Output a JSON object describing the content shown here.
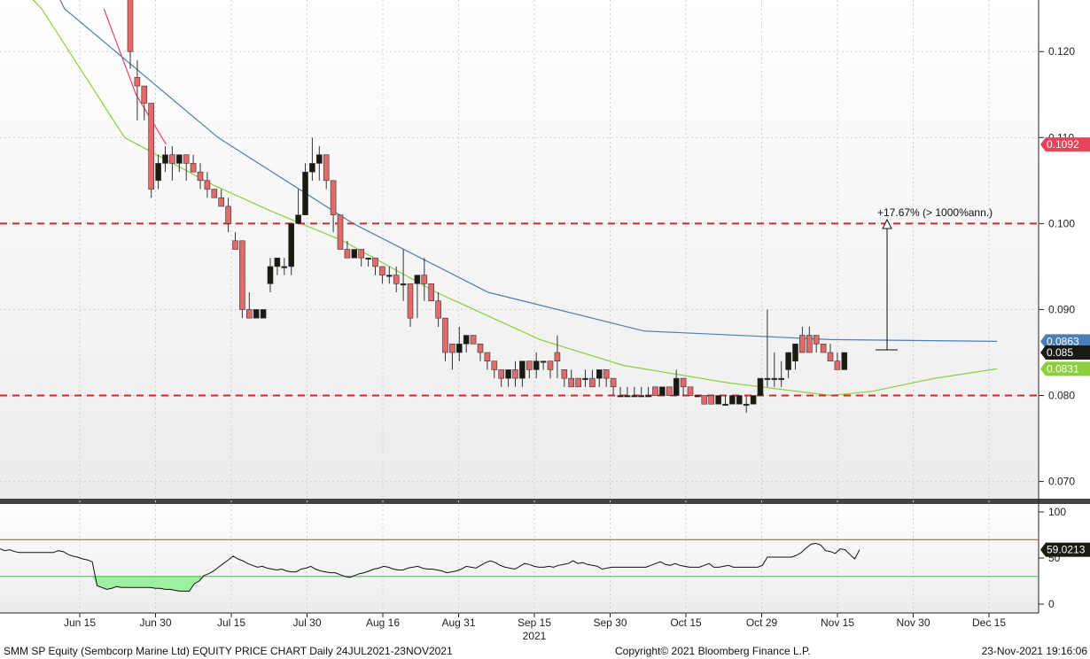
{
  "chart_data": [
    {
      "type": "candlestick",
      "title": "",
      "y_axis_side": "right",
      "ylim": [
        0.068,
        0.126
      ],
      "y_ticks": [
        "0.070",
        "0.080",
        "0.090",
        "0.100",
        "0.110",
        "0.120"
      ],
      "x_ticks": [
        "Jun 15",
        "Jun 30",
        "Jul 15",
        "Jul 30",
        "Aug 16",
        "Aug 31",
        "Sep 15",
        "Sep 30",
        "Oct 15",
        "Oct 29",
        "Nov 15",
        "Nov 30",
        "Dec 15"
      ],
      "x_year_label": "2021",
      "candles": [
        [
          0.13,
          0.131,
          0.118,
          0.12
        ],
        [
          0.117,
          0.119,
          0.112,
          0.116
        ],
        [
          0.116,
          0.116,
          0.112,
          0.114
        ],
        [
          0.114,
          0.114,
          0.103,
          0.104
        ],
        [
          0.105,
          0.108,
          0.104,
          0.107
        ],
        [
          0.107,
          0.109,
          0.106,
          0.108
        ],
        [
          0.108,
          0.109,
          0.105,
          0.107
        ],
        [
          0.107,
          0.108,
          0.106,
          0.108
        ],
        [
          0.108,
          0.108,
          0.105,
          0.107
        ],
        [
          0.107,
          0.108,
          0.106,
          0.106
        ],
        [
          0.106,
          0.107,
          0.104,
          0.105
        ],
        [
          0.105,
          0.106,
          0.103,
          0.104
        ],
        [
          0.104,
          0.104,
          0.103,
          0.103
        ],
        [
          0.103,
          0.104,
          0.102,
          0.102
        ],
        [
          0.102,
          0.103,
          0.099,
          0.1
        ],
        [
          0.098,
          0.099,
          0.097,
          0.097
        ],
        [
          0.098,
          0.098,
          0.089,
          0.09
        ],
        [
          0.09,
          0.092,
          0.089,
          0.089
        ],
        [
          0.089,
          0.09,
          0.089,
          0.09
        ],
        [
          0.089,
          0.09,
          0.089,
          0.09
        ],
        [
          0.093,
          0.096,
          0.092,
          0.095
        ],
        [
          0.095,
          0.096,
          0.094,
          0.096
        ],
        [
          0.095,
          0.096,
          0.094,
          0.095
        ],
        [
          0.095,
          0.1,
          0.094,
          0.1
        ],
        [
          0.1,
          0.104,
          0.1,
          0.101
        ],
        [
          0.101,
          0.107,
          0.101,
          0.106
        ],
        [
          0.106,
          0.11,
          0.105,
          0.107
        ],
        [
          0.107,
          0.109,
          0.105,
          0.108
        ],
        [
          0.108,
          0.108,
          0.104,
          0.105
        ],
        [
          0.105,
          0.105,
          0.099,
          0.101
        ],
        [
          0.101,
          0.101,
          0.098,
          0.097
        ],
        [
          0.097,
          0.098,
          0.096,
          0.096
        ],
        [
          0.096,
          0.097,
          0.096,
          0.097
        ],
        [
          0.097,
          0.097,
          0.095,
          0.096
        ],
        [
          0.096,
          0.096,
          0.095,
          0.096
        ],
        [
          0.096,
          0.096,
          0.094,
          0.095
        ],
        [
          0.095,
          0.095,
          0.093,
          0.094
        ],
        [
          0.094,
          0.095,
          0.093,
          0.094
        ],
        [
          0.094,
          0.095,
          0.092,
          0.093
        ],
        [
          0.093,
          0.097,
          0.091,
          0.093
        ],
        [
          0.093,
          0.093,
          0.088,
          0.089
        ],
        [
          0.093,
          0.094,
          0.089,
          0.094
        ],
        [
          0.094,
          0.096,
          0.091,
          0.093
        ],
        [
          0.093,
          0.093,
          0.091,
          0.091
        ],
        [
          0.091,
          0.092,
          0.088,
          0.089
        ],
        [
          0.089,
          0.089,
          0.084,
          0.085
        ],
        [
          0.086,
          0.086,
          0.083,
          0.085
        ],
        [
          0.085,
          0.088,
          0.084,
          0.086
        ],
        [
          0.086,
          0.087,
          0.085,
          0.087
        ],
        [
          0.087,
          0.087,
          0.086,
          0.086
        ],
        [
          0.086,
          0.086,
          0.084,
          0.085
        ],
        [
          0.085,
          0.085,
          0.083,
          0.084
        ],
        [
          0.084,
          0.084,
          0.082,
          0.083
        ],
        [
          0.083,
          0.083,
          0.081,
          0.082
        ],
        [
          0.082,
          0.083,
          0.081,
          0.083
        ],
        [
          0.083,
          0.084,
          0.081,
          0.082
        ],
        [
          0.082,
          0.084,
          0.081,
          0.084
        ],
        [
          0.084,
          0.084,
          0.082,
          0.083
        ],
        [
          0.083,
          0.085,
          0.082,
          0.084
        ],
        [
          0.084,
          0.084,
          0.083,
          0.084
        ],
        [
          0.084,
          0.084,
          0.082,
          0.083
        ],
        [
          0.085,
          0.087,
          0.082,
          0.084
        ],
        [
          0.083,
          0.083,
          0.081,
          0.082
        ],
        [
          0.082,
          0.083,
          0.081,
          0.081
        ],
        [
          0.082,
          0.082,
          0.081,
          0.081
        ],
        [
          0.082,
          0.083,
          0.081,
          0.082
        ],
        [
          0.082,
          0.083,
          0.081,
          0.081
        ],
        [
          0.082,
          0.083,
          0.081,
          0.083
        ],
        [
          0.083,
          0.083,
          0.081,
          0.082
        ],
        [
          0.082,
          0.082,
          0.08,
          0.081
        ],
        [
          0.08,
          0.081,
          0.08,
          0.08
        ],
        [
          0.08,
          0.081,
          0.08,
          0.08
        ],
        [
          0.08,
          0.081,
          0.08,
          0.08
        ],
        [
          0.08,
          0.081,
          0.08,
          0.08
        ],
        [
          0.08,
          0.081,
          0.08,
          0.08
        ],
        [
          0.081,
          0.081,
          0.08,
          0.08
        ],
        [
          0.08,
          0.081,
          0.08,
          0.081
        ],
        [
          0.081,
          0.081,
          0.08,
          0.08
        ],
        [
          0.08,
          0.083,
          0.08,
          0.082
        ],
        [
          0.082,
          0.082,
          0.08,
          0.081
        ],
        [
          0.081,
          0.081,
          0.08,
          0.08
        ],
        [
          0.08,
          0.08,
          0.08,
          0.08
        ],
        [
          0.08,
          0.08,
          0.079,
          0.079
        ],
        [
          0.08,
          0.08,
          0.079,
          0.079
        ],
        [
          0.079,
          0.08,
          0.079,
          0.08
        ],
        [
          0.079,
          0.08,
          0.079,
          0.079
        ],
        [
          0.079,
          0.08,
          0.079,
          0.08
        ],
        [
          0.079,
          0.08,
          0.079,
          0.08
        ],
        [
          0.079,
          0.08,
          0.078,
          0.079
        ],
        [
          0.079,
          0.08,
          0.079,
          0.08
        ],
        [
          0.08,
          0.082,
          0.08,
          0.082
        ],
        [
          0.082,
          0.09,
          0.081,
          0.082
        ],
        [
          0.082,
          0.085,
          0.081,
          0.082
        ],
        [
          0.082,
          0.084,
          0.081,
          0.082
        ],
        [
          0.083,
          0.085,
          0.082,
          0.085
        ],
        [
          0.084,
          0.086,
          0.083,
          0.086
        ],
        [
          0.087,
          0.088,
          0.085,
          0.085
        ],
        [
          0.087,
          0.088,
          0.085,
          0.085
        ],
        [
          0.087,
          0.087,
          0.085,
          0.086
        ],
        [
          0.086,
          0.086,
          0.085,
          0.085
        ],
        [
          0.085,
          0.086,
          0.084,
          0.084
        ],
        [
          0.084,
          0.085,
          0.083,
          0.083
        ],
        [
          0.083,
          0.085,
          0.083,
          0.085
        ]
      ],
      "moving_averages": [
        {
          "color": "#e8435a",
          "values": [
            [
              0.1,
              0.125
            ],
            [
              0.131,
              0.115
            ],
            [
              0.16,
              0.1092
            ]
          ],
          "tag": "0.1092"
        },
        {
          "color": "#4a7fb5",
          "values": [
            [
              0.0,
              0.14
            ],
            [
              0.062,
              0.125
            ],
            [
              0.21,
              0.11
            ],
            [
              0.34,
              0.1
            ],
            [
              0.47,
              0.092
            ],
            [
              0.62,
              0.0875
            ],
            [
              0.8,
              0.0865
            ],
            [
              0.96,
              0.0863
            ]
          ],
          "tag": "0.0863"
        },
        {
          "color": "#8ccf3c",
          "values": [
            [
              0.0,
              0.13
            ],
            [
              0.04,
              0.125
            ],
            [
              0.12,
              0.11
            ],
            [
              0.205,
              0.1045
            ],
            [
              0.26,
              0.1015
            ],
            [
              0.33,
              0.098
            ],
            [
              0.42,
              0.092
            ],
            [
              0.52,
              0.0865
            ],
            [
              0.6,
              0.0835
            ],
            [
              0.7,
              0.0815
            ],
            [
              0.8,
              0.08
            ],
            [
              0.84,
              0.0805
            ],
            [
              0.9,
              0.082
            ],
            [
              0.96,
              0.0831
            ]
          ],
          "tag": "0.0831"
        }
      ],
      "last_price_tag": "0.085",
      "horizontal_lines": [
        0.1,
        0.08
      ],
      "annotation": "+17.67% (> 1000%ann.)"
    },
    {
      "type": "line",
      "ylim": [
        0,
        100
      ],
      "y_ticks": [
        "0",
        "50",
        "100"
      ],
      "bands": [
        30,
        70
      ],
      "last_value_tag": "59.0213",
      "values": [
        60,
        58,
        59,
        57,
        56,
        56,
        56,
        56,
        56,
        56,
        56,
        56,
        58,
        57,
        54,
        52,
        51,
        49,
        48,
        46,
        20,
        18,
        16,
        17,
        19,
        18,
        18,
        18,
        18,
        18,
        18,
        18,
        17,
        17,
        16,
        16,
        15,
        14,
        14,
        14,
        22,
        25,
        31,
        33,
        36,
        40,
        44,
        48,
        52,
        49,
        47,
        44,
        42,
        40,
        41,
        39,
        38,
        37,
        38,
        36,
        35,
        35,
        38,
        39,
        41,
        38,
        36,
        35,
        34,
        34,
        32,
        30,
        29,
        31,
        33,
        34,
        36,
        38,
        39,
        41,
        40,
        38,
        37,
        37,
        39,
        40,
        41,
        39,
        38,
        38,
        37,
        36,
        34,
        35,
        36,
        38,
        41,
        40,
        39,
        42,
        45,
        47,
        45,
        42,
        40,
        39,
        38,
        41,
        44,
        43,
        41,
        40,
        40,
        41,
        40,
        42,
        43,
        44,
        47,
        44,
        45,
        43,
        42,
        41,
        38,
        39,
        40,
        40,
        40,
        40,
        40,
        40,
        40,
        40,
        42,
        44,
        46,
        43,
        42,
        44,
        42,
        41,
        40,
        40,
        40,
        42,
        44,
        40,
        40,
        41,
        42,
        40,
        40,
        40,
        40,
        40,
        40,
        42,
        51,
        51,
        51,
        51,
        51,
        51,
        53,
        56,
        61,
        65,
        66,
        64,
        58,
        57,
        55,
        60,
        59,
        54,
        49,
        59
      ]
    }
  ],
  "footer": {
    "security": "SMM SP Equity (Sembcorp Marine Ltd) EQUITY PRICE CHART  Daily 24JUL2021-23NOV2021",
    "copyright": "Copyright© 2021 Bloomberg Finance L.P.",
    "timestamp": "23-Nov-2021 19:16:06"
  },
  "colors": {
    "up_candle": "#1a1a12",
    "down_candle": "#e26a6a",
    "ref_line": "#d9262b",
    "upper_band": "#c0392b",
    "lower_band": "#3fbf3f",
    "band_fill": "#9cf0a0"
  }
}
